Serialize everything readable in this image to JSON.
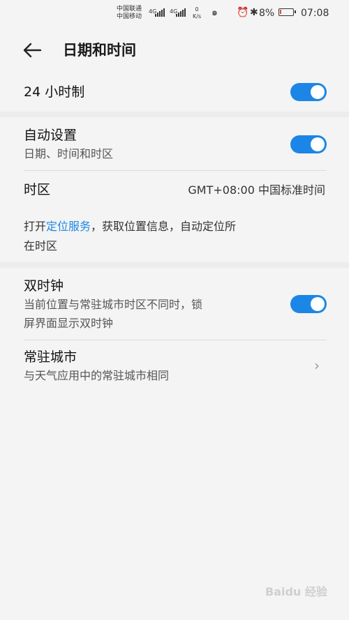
{
  "status_bar": {
    "carrier1": "中国联通",
    "carrier2": "中国移动",
    "net1": "4G",
    "net2": "4G",
    "speed_value": "0",
    "speed_unit": "K/s",
    "battery": "8%",
    "time": "07:08",
    "icons": [
      "signal-icon",
      "sync-icon",
      "alarm-icon",
      "bluetooth-icon",
      "battery-icon"
    ]
  },
  "header": {
    "title": "日期和时间",
    "back_icon": "back-arrow-icon"
  },
  "settings": {
    "hour24_label": "24 小时制",
    "hour24_on": true,
    "auto_label": "自动设置",
    "auto_sub": "日期、时间和时区",
    "auto_on": true,
    "timezone_label": "时区",
    "timezone_value": "GMT+08:00 中国标准时间",
    "location_hint_pre": "打开",
    "location_hint_link": "定位服务",
    "location_hint_post": "，获取位置信息，自动定位所",
    "location_hint_line2": "在时区",
    "dual_label": "双时钟",
    "dual_sub1": "当前位置与常驻城市时区不同时，锁",
    "dual_sub2": "屏界面显示双时钟",
    "dual_on": true,
    "home_city_label": "常驻城市",
    "home_city_sub": "与天气应用中的常驻城市相同"
  },
  "watermark": "Baidu 经验",
  "colors": {
    "accent": "#1b86e6",
    "battery_low": "#e84a3a"
  }
}
